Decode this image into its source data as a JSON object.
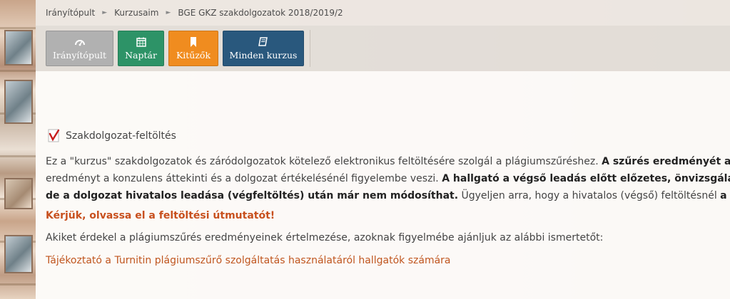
{
  "breadcrumb": {
    "items": [
      "Irányítópult",
      "Kurzusaim",
      "BGE GKZ szakdolgozatok 2018/2019/2"
    ]
  },
  "navbar": {
    "buttons": [
      {
        "label": "Irányítópult",
        "icon": "dashboard-icon",
        "color": "#b1b1b1"
      },
      {
        "label": "Naptár",
        "icon": "calendar-icon",
        "color": "#2d9367"
      },
      {
        "label": "Kitűzők",
        "icon": "bookmark-icon",
        "color": "#f08c1f"
      },
      {
        "label": "Minden kurzus",
        "icon": "book-icon",
        "color": "#29587d"
      }
    ]
  },
  "activity": {
    "icon": "turnitin-icon",
    "title": "Szakdolgozat-feltöltés"
  },
  "description": {
    "line1_normal": "Ez a \"kurzus\" szakdolgozatok és záródolgozatok kötelező elektronikus feltöltésére szolgál a plágiumszűréshez. ",
    "line1_bold": "A szűrés eredményét a ha",
    "line2_normal": "eredményt a konzulens áttekinti és a dolgozat értékelésénél figyelembe veszi. ",
    "line2_bold": "A hallgató a végső leadás előtt előzetes, önvizsgálati célú",
    "line3_bold": "de a dolgozat hivatalos leadása (végfeltöltés) után már nem módosíthat.",
    "line3_normal": " Ügyeljen arra, hogy a hivatalos (végső) feltöltésnél ",
    "line3_bold2": "a cím mezőbe"
  },
  "warning": "Kérjük, olvassa el a feltöltési útmutatót!",
  "interest_text": "Akiket érdekel a plágiumszűrés eredményeinek értelmezése, azoknak figyelmébe ajánljuk az alábbi ismertetőt:",
  "link_text": "Tájékoztató a Turnitin plágiumszűrő szolgáltatás használatáról hallgatók számára",
  "colors": {
    "accent_orange": "#c0561f",
    "warning_orange": "#c8501e"
  }
}
